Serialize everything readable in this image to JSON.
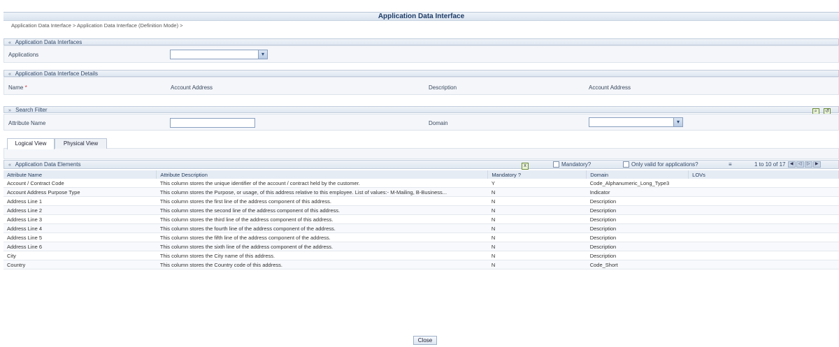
{
  "window": {
    "title": "Application Data Interface",
    "breadcrumb": "Application Data Interface > Application Data Interface (Definition Mode) >"
  },
  "section_interfaces": {
    "title": "Application Data Interfaces",
    "applications_label": "Applications",
    "applications_value": ""
  },
  "section_details": {
    "title": "Application Data Interface Details",
    "name_label": "Name",
    "name_required_mark": "*",
    "name_value": "Account Address",
    "description_label": "Description",
    "description_value": "Account Address"
  },
  "section_search": {
    "title": "Search Filter",
    "attribute_name_label": "Attribute Name",
    "attribute_name_value": "",
    "domain_label": "Domain",
    "domain_value": "",
    "search_icon": "search-icon",
    "reset_icon": "reset-icon"
  },
  "tabs": [
    {
      "label": "Logical View",
      "active": true
    },
    {
      "label": "Physical View",
      "active": false
    }
  ],
  "elements_section": {
    "title": "Application Data Elements",
    "export_icon": "excel-export-icon",
    "mandatory_filter_label": "Mandatory?",
    "valid_filter_label": "Only valid for applications?",
    "sort_icon": "sort-icon",
    "pagination_text": "1 to 10 of 17"
  },
  "grid": {
    "columns": [
      "Attribute Name",
      "Attribute Description",
      "Mandatory ?",
      "Domain",
      "LOVs"
    ],
    "rows": [
      [
        "Account / Contract Code",
        "This column stores the unique identifier of the account / contract held by the customer.",
        "Y",
        "Code_Alphanumeric_Long_Type3",
        ""
      ],
      [
        "Account Address Purpose Type",
        "This column stores the Purpose, or usage, of this address relative to this employee. List of values:- M-Mailing, B-Business...",
        "N",
        "Indicator",
        ""
      ],
      [
        "Address Line 1",
        "This column stores the first line of the address component of this address.",
        "N",
        "Description",
        ""
      ],
      [
        "Address Line 2",
        "This column stores the second line of the address component of this address.",
        "N",
        "Description",
        ""
      ],
      [
        "Address Line 3",
        "This column stores the third line of the address component of this address.",
        "N",
        "Description",
        ""
      ],
      [
        "Address Line 4",
        "This column stores the fourth line of the address component of the address.",
        "N",
        "Description",
        ""
      ],
      [
        "Address Line 5",
        "This column stores the fifth line of the address component of the address.",
        "N",
        "Description",
        ""
      ],
      [
        "Address Line 6",
        "This column stores the sixth line of the address component of the address.",
        "N",
        "Description",
        ""
      ],
      [
        "City",
        "This column stores the City name of this address.",
        "N",
        "Description",
        ""
      ],
      [
        "Country",
        "This column stores the Country code of this address.",
        "N",
        "Code_Short",
        ""
      ]
    ]
  },
  "footer": {
    "close_label": "Close"
  }
}
